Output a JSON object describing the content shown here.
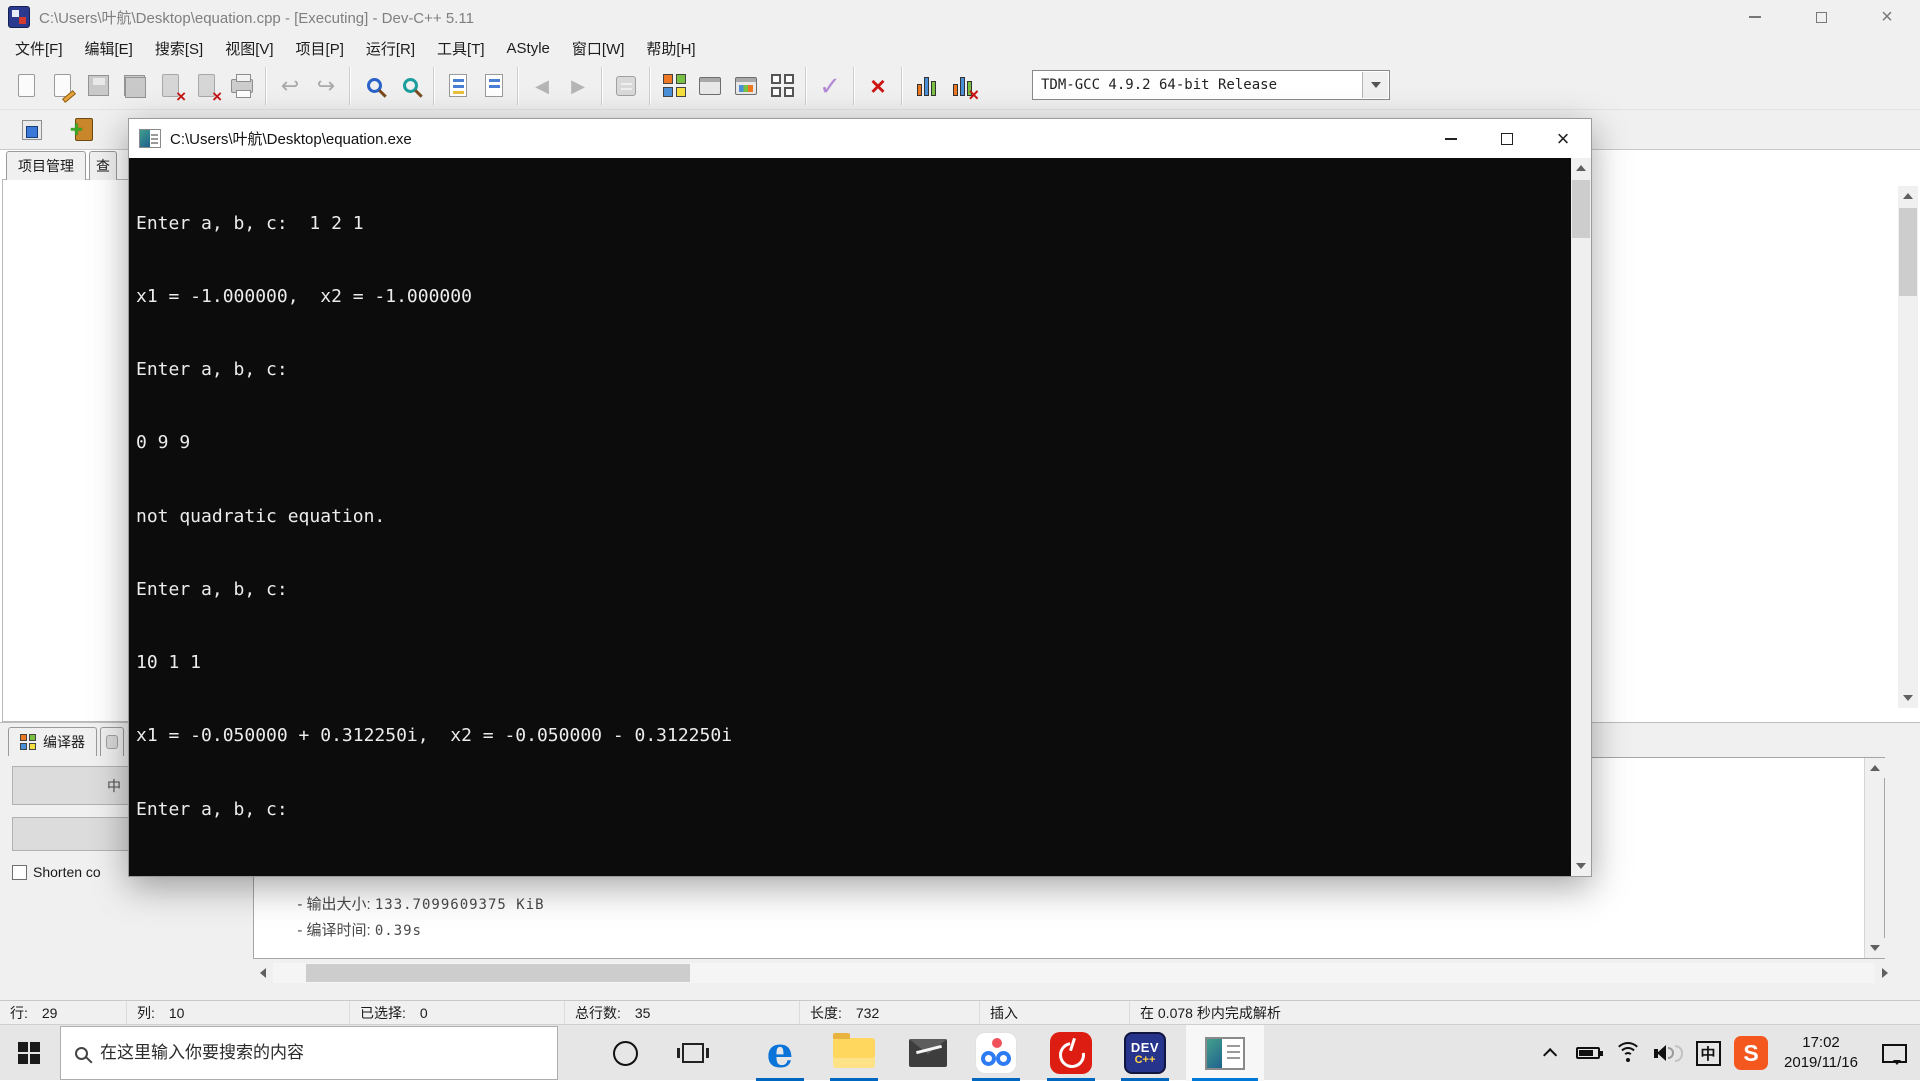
{
  "window": {
    "title": "C:\\Users\\叶航\\Desktop\\equation.cpp - [Executing] - Dev-C++ 5.11"
  },
  "menu": {
    "items": [
      "文件[F]",
      "编辑[E]",
      "搜索[S]",
      "视图[V]",
      "项目[P]",
      "运行[R]",
      "工具[T]",
      "AStyle",
      "窗口[W]",
      "帮助[H]"
    ]
  },
  "toolbar": {
    "compiler_profile": "TDM-GCC 4.9.2 64-bit Release"
  },
  "left_panel": {
    "tabs": [
      "项目管理",
      "查"
    ]
  },
  "console": {
    "title": "C:\\Users\\叶航\\Desktop\\equation.exe",
    "lines": [
      "Enter a, b, c:  1 2 1",
      "x1 = -1.000000,  x2 = -1.000000",
      "Enter a, b, c:",
      "0 9 9",
      "not quadratic equation.",
      "Enter a, b, c:",
      "10 1 1",
      "x1 = -0.050000 + 0.312250i,  x2 = -0.050000 - 0.312250i",
      "Enter a, b, c:"
    ]
  },
  "bottom_panel": {
    "tab_label": "编译器",
    "abort_label": "中",
    "checkbox_label": "Shorten co",
    "log": [
      {
        "label": "- 输出大小: ",
        "value": "133.7099609375 KiB"
      },
      {
        "label": "- 编译时间: ",
        "value": "0.39s"
      }
    ]
  },
  "status_bar": {
    "cells": [
      {
        "label": "行:",
        "value": "29"
      },
      {
        "label": "列:",
        "value": "10"
      },
      {
        "label": "已选择:",
        "value": "0"
      },
      {
        "label": "总行数:",
        "value": "35"
      },
      {
        "label": "长度:",
        "value": "732"
      },
      {
        "label": "插入",
        "value": ""
      },
      {
        "label": "在 0.078 秒内完成解析",
        "value": ""
      }
    ]
  },
  "taskbar": {
    "search_placeholder": "在这里输入你要搜索的内容",
    "ime_label": "中",
    "clock_time": "17:02",
    "clock_date": "2019/11/16"
  },
  "icons": {
    "undo": "↩",
    "redo": "↪",
    "back": "◀",
    "forward": "▶",
    "check": "✓",
    "cross": "×",
    "edge": "e",
    "dev_line1": "DEV",
    "dev_line2": "C++",
    "sogou": "S",
    "plus": "+",
    "close": "×"
  }
}
